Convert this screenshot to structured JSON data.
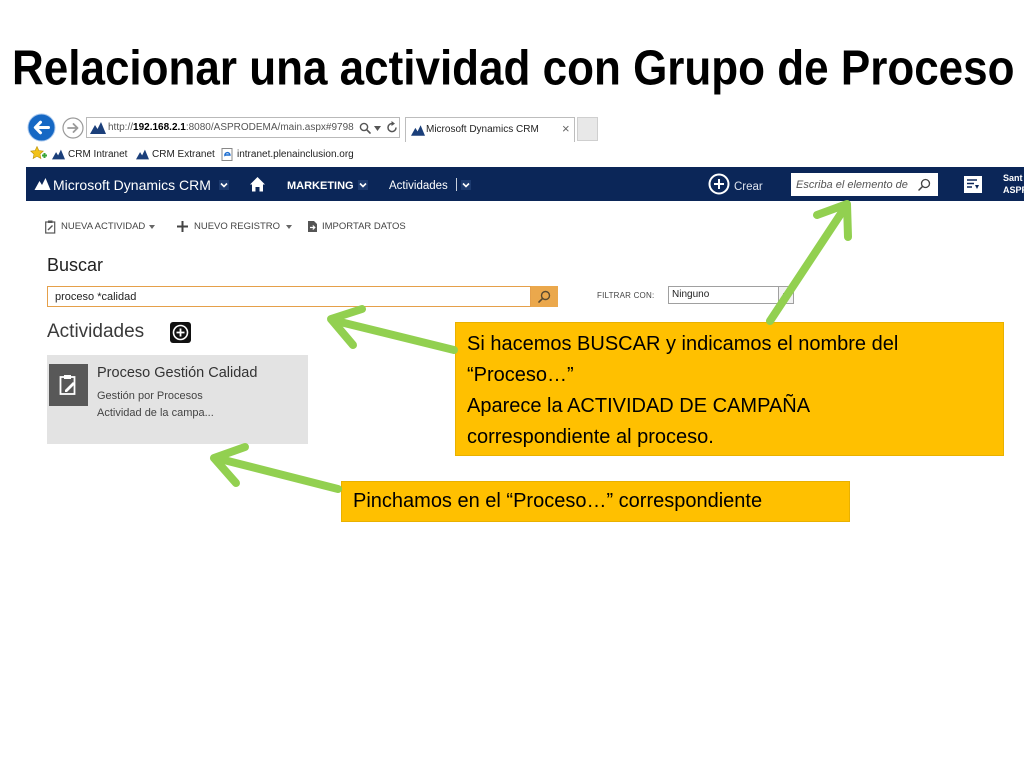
{
  "slide": {
    "title": "Relacionar una actividad con Grupo de Proceso"
  },
  "browser": {
    "back_icon": "back-arrow-icon",
    "forward_icon": "forward-arrow-icon",
    "address": {
      "scheme": "http://",
      "host": "192.168.2.1",
      "path": ":8080/ASPRODEMA/main.aspx#9798"
    },
    "tab": {
      "title": "Microsoft Dynamics CRM",
      "close": "×"
    },
    "favorites": [
      {
        "label": "CRM Intranet",
        "icon": "crm-logo-icon"
      },
      {
        "label": "CRM Extranet",
        "icon": "crm-logo-icon"
      },
      {
        "label": "intranet.plenainclusion.org",
        "icon": "ie-page-icon"
      }
    ]
  },
  "crm": {
    "nav": {
      "brand": "Microsoft Dynamics CRM",
      "area": "MARKETING",
      "entity": "Actividades",
      "create": "Crear",
      "search_placeholder": "Escriba el elemento de",
      "user": [
        "Sant",
        "ASPR"
      ]
    },
    "commands": [
      {
        "label": "NUEVA ACTIVIDAD",
        "icon": "new-activity-icon",
        "has_menu": true
      },
      {
        "label": "NUEVO REGISTRO",
        "icon": "plus-icon",
        "has_menu": true
      },
      {
        "label": "IMPORTAR DATOS",
        "icon": "import-icon",
        "has_menu": false
      }
    ],
    "search": {
      "heading": "Buscar",
      "query": "proceso *calidad",
      "filter_label": "FILTRAR CON:",
      "filter_value": "Ninguno"
    },
    "results": {
      "heading": "Actividades",
      "cards": [
        {
          "title": "Proceso Gestión Calidad",
          "subtitle": "Gestión por Procesos",
          "detail": "Actividad de la campa...",
          "icon": "campaign-activity-icon"
        }
      ]
    }
  },
  "callouts": [
    {
      "lines": [
        "Si hacemos BUSCAR y indicamos el nombre del",
        "“Proceso…”",
        "Aparece la ACTIVIDAD DE CAMPAÑA",
        "correspondiente al proceso."
      ]
    },
    {
      "lines": [
        "Pinchamos en el “Proceso…” correspondiente"
      ]
    }
  ],
  "colors": {
    "nav_bar": "#0b2658",
    "callout": "#FFC000",
    "arrow": "#92D050",
    "search_border": "#E5A04A",
    "search_button": "#EBA84C",
    "card": "#E3E3E3",
    "card_icon": "#585858",
    "back_button": "#1668C4"
  }
}
